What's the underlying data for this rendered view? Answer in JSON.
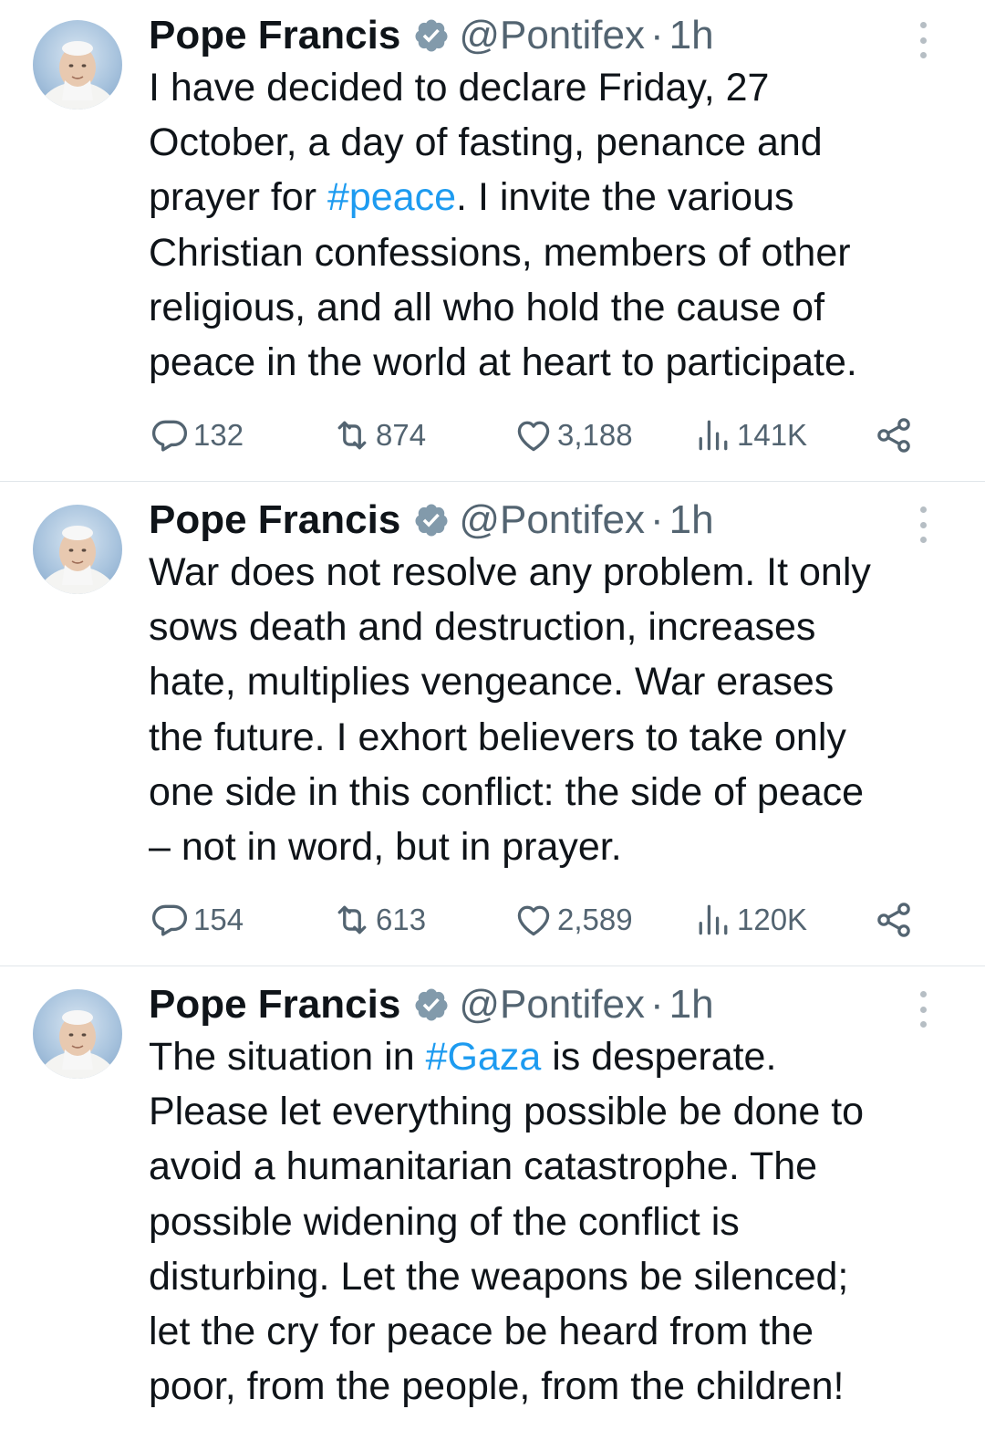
{
  "tweets": [
    {
      "author_name": "Pope Francis",
      "handle": "@Pontifex",
      "separator": "·",
      "time": "1h",
      "text_parts": [
        {
          "t": "I have decided to declare Friday, 27\nOctober, a day of fasting, penance and\nprayer for ",
          "tag": false
        },
        {
          "t": "#peace",
          "tag": true
        },
        {
          "t": ". I invite the various\nChristian confessions, members of other\nreligious, and all who hold the cause of\npeace in the world at heart to participate.",
          "tag": false
        }
      ],
      "replies": "132",
      "reposts": "874",
      "likes": "3,188",
      "views": "141K"
    },
    {
      "author_name": "Pope Francis",
      "handle": "@Pontifex",
      "separator": "·",
      "time": "1h",
      "text_parts": [
        {
          "t": "War does not resolve any problem. It only\nsows death and destruction, increases\nhate, multiplies vengeance. War erases\nthe future. I exhort believers to take only\none side in this conflict: the side of peace\n– not in word, but in prayer.",
          "tag": false
        }
      ],
      "replies": "154",
      "reposts": "613",
      "likes": "2,589",
      "views": "120K"
    },
    {
      "author_name": "Pope Francis",
      "handle": "@Pontifex",
      "separator": "·",
      "time": "1h",
      "text_parts": [
        {
          "t": "The situation in ",
          "tag": false
        },
        {
          "t": "#Gaza",
          "tag": true
        },
        {
          "t": " is desperate.\nPlease let everything possible be done to\navoid a humanitarian catastrophe. The\npossible widening of the conflict is\ndisturbing. Let the weapons be silenced;\nlet the cry for peace be heard from the\npoor, from the people, from the children!",
          "tag": false
        }
      ]
    }
  ],
  "icons": {
    "avatar": "pope-portrait",
    "verified": "verified-badge-icon",
    "more": "more-vertical-icon",
    "reply": "reply-icon",
    "repost": "repost-icon",
    "like": "like-icon",
    "views": "views-icon",
    "share": "share-icon"
  },
  "colors": {
    "text": "#0f1419",
    "secondary": "#536471",
    "hashtag": "#1d9bf0",
    "verified_badge": "#829aab",
    "divider": "#e1e6ea"
  }
}
